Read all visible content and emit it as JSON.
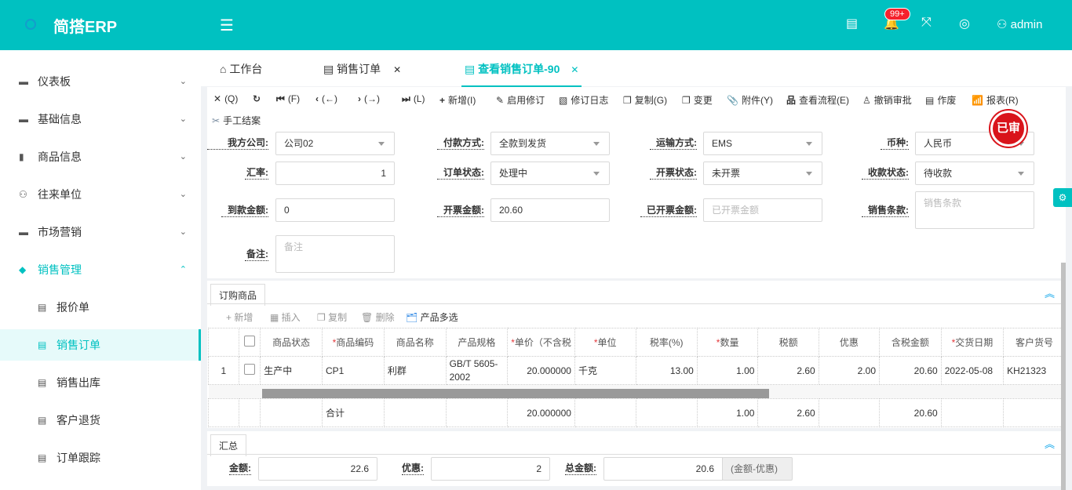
{
  "app": {
    "title": "简搭ERP",
    "user": "admin",
    "badge": "99+"
  },
  "sidebar": {
    "items": [
      {
        "label": "仪表板",
        "icon": "folder-icon"
      },
      {
        "label": "基础信息",
        "icon": "folder-icon"
      },
      {
        "label": "商品信息",
        "icon": "book-icon"
      },
      {
        "label": "往来单位",
        "icon": "contacts-icon"
      },
      {
        "label": "市场营销",
        "icon": "folder-icon"
      },
      {
        "label": "销售管理",
        "icon": "tag-icon"
      },
      {
        "label": "报价单",
        "icon": "document-icon"
      },
      {
        "label": "销售订单",
        "icon": "document-icon"
      },
      {
        "label": "销售出库",
        "icon": "document-icon"
      },
      {
        "label": "客户退货",
        "icon": "document-icon"
      },
      {
        "label": "订单跟踪",
        "icon": "document-icon"
      }
    ]
  },
  "tabs": [
    {
      "label": "工作台"
    },
    {
      "label": "销售订单"
    },
    {
      "label": "查看销售订单-90"
    }
  ],
  "toolbar": [
    "(Q)",
    "(F)",
    "(←)",
    "(→)",
    "(L)",
    "新增(I)",
    "启用修订",
    "修订日志",
    "复制(G)",
    "变更",
    "附件(Y)",
    "查看流程(E)",
    "撤销审批",
    "作废",
    "报表(R)",
    "手工结案"
  ],
  "stamp": "已审",
  "form": {
    "company": {
      "label": "我方公司:",
      "value": "公司02"
    },
    "payment": {
      "label": "付款方式:",
      "value": "全款到发货"
    },
    "shipping": {
      "label": "运输方式:",
      "value": "EMS"
    },
    "currency": {
      "label": "币种:",
      "value": "人民币"
    },
    "rate": {
      "label": "汇率:",
      "value": "1"
    },
    "order_status": {
      "label": "订单状态:",
      "value": "处理中"
    },
    "invoice_status": {
      "label": "开票状态:",
      "value": "未开票"
    },
    "receipt_status": {
      "label": "收款状态:",
      "value": "待收款"
    },
    "received": {
      "label": "到款金额:",
      "value": "0"
    },
    "invoice_amount": {
      "label": "开票金额:",
      "value": "20.60"
    },
    "invoiced": {
      "label": "已开票金额:",
      "placeholder": "已开票金额"
    },
    "terms": {
      "label": "销售条款:",
      "placeholder": "销售条款"
    },
    "remark": {
      "label": "备注:",
      "placeholder": "备注"
    }
  },
  "items": {
    "tab": "订购商品",
    "actions": [
      "新增",
      "插入",
      "复制",
      "删除",
      "产品多选"
    ],
    "columns": [
      "商品状态",
      "商品编码",
      "商品名称",
      "产品规格",
      "单价（不含税",
      "单位",
      "税率(%)",
      "数量",
      "税额",
      "优惠",
      "含税金额",
      "交货日期",
      "客户货号"
    ],
    "rows": [
      {
        "no": "1",
        "status": "生产中",
        "code": "CP1",
        "name": "利群",
        "spec": "GB/T 5605-2002",
        "price": "20.000000",
        "unit": "千克",
        "tax_rate": "13.00",
        "qty": "1.00",
        "tax": "2.60",
        "discount": "2.00",
        "total": "20.60",
        "date": "2022-05-08",
        "cust_no": "KH21323"
      }
    ],
    "totals": {
      "label": "合计",
      "price": "20.000000",
      "qty": "1.00",
      "tax": "2.60",
      "total": "20.60"
    }
  },
  "summary": {
    "tab": "汇总",
    "amount_label": "金额:",
    "amount": "22.6",
    "discount_label": "优惠:",
    "discount": "2",
    "total_label": "总金额:",
    "total": "20.6",
    "note": "(金额-优惠)"
  }
}
